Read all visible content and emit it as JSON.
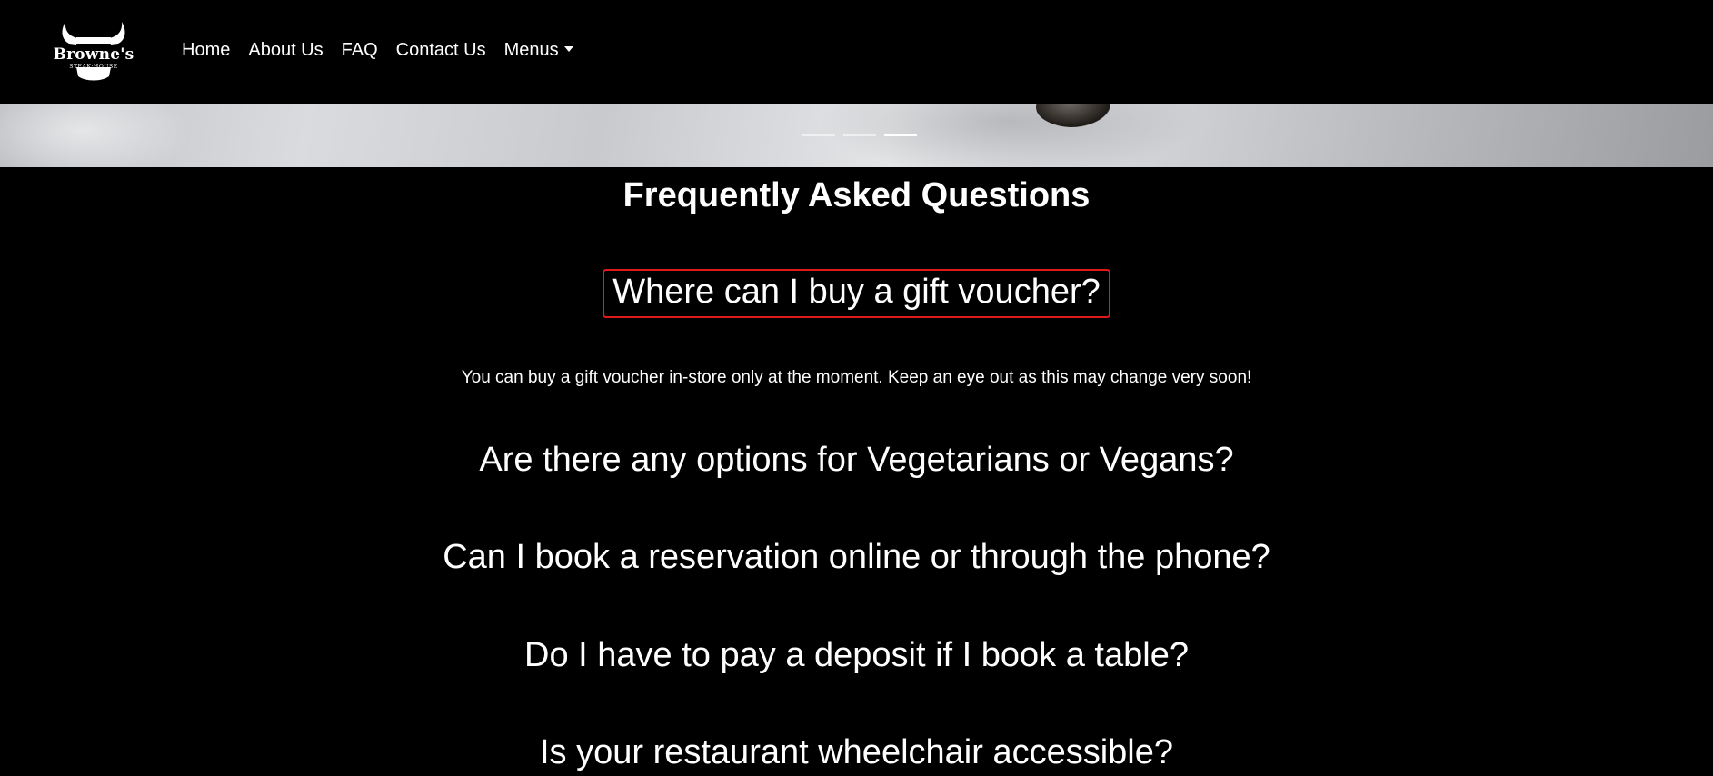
{
  "brand": {
    "name": "Browne's",
    "tagline": "STEAK·HOUSE"
  },
  "nav": {
    "links": [
      {
        "label": "Home"
      },
      {
        "label": "About Us"
      },
      {
        "label": "FAQ"
      },
      {
        "label": "Contact Us"
      },
      {
        "label": "Menus"
      }
    ]
  },
  "carousel": {
    "slide_count": 3,
    "active_index": 2
  },
  "faq": {
    "title": "Frequently Asked Questions",
    "items": [
      {
        "question": "Where can I buy a gift voucher?",
        "answer": "You can buy a gift voucher in-store only at the moment. Keep an eye out as this may change very soon!",
        "expanded": true
      },
      {
        "question": "Are there any options for Vegetarians or Vegans?",
        "expanded": false
      },
      {
        "question": "Can I book a reservation online or through the phone?",
        "expanded": false
      },
      {
        "question": "Do I have to pay a deposit if I book a table?",
        "expanded": false
      },
      {
        "question": "Is your restaurant wheelchair accessible?",
        "expanded": false
      }
    ]
  },
  "colors": {
    "background": "#000000",
    "text": "#ffffff",
    "focus_outline": "#e0191b"
  }
}
